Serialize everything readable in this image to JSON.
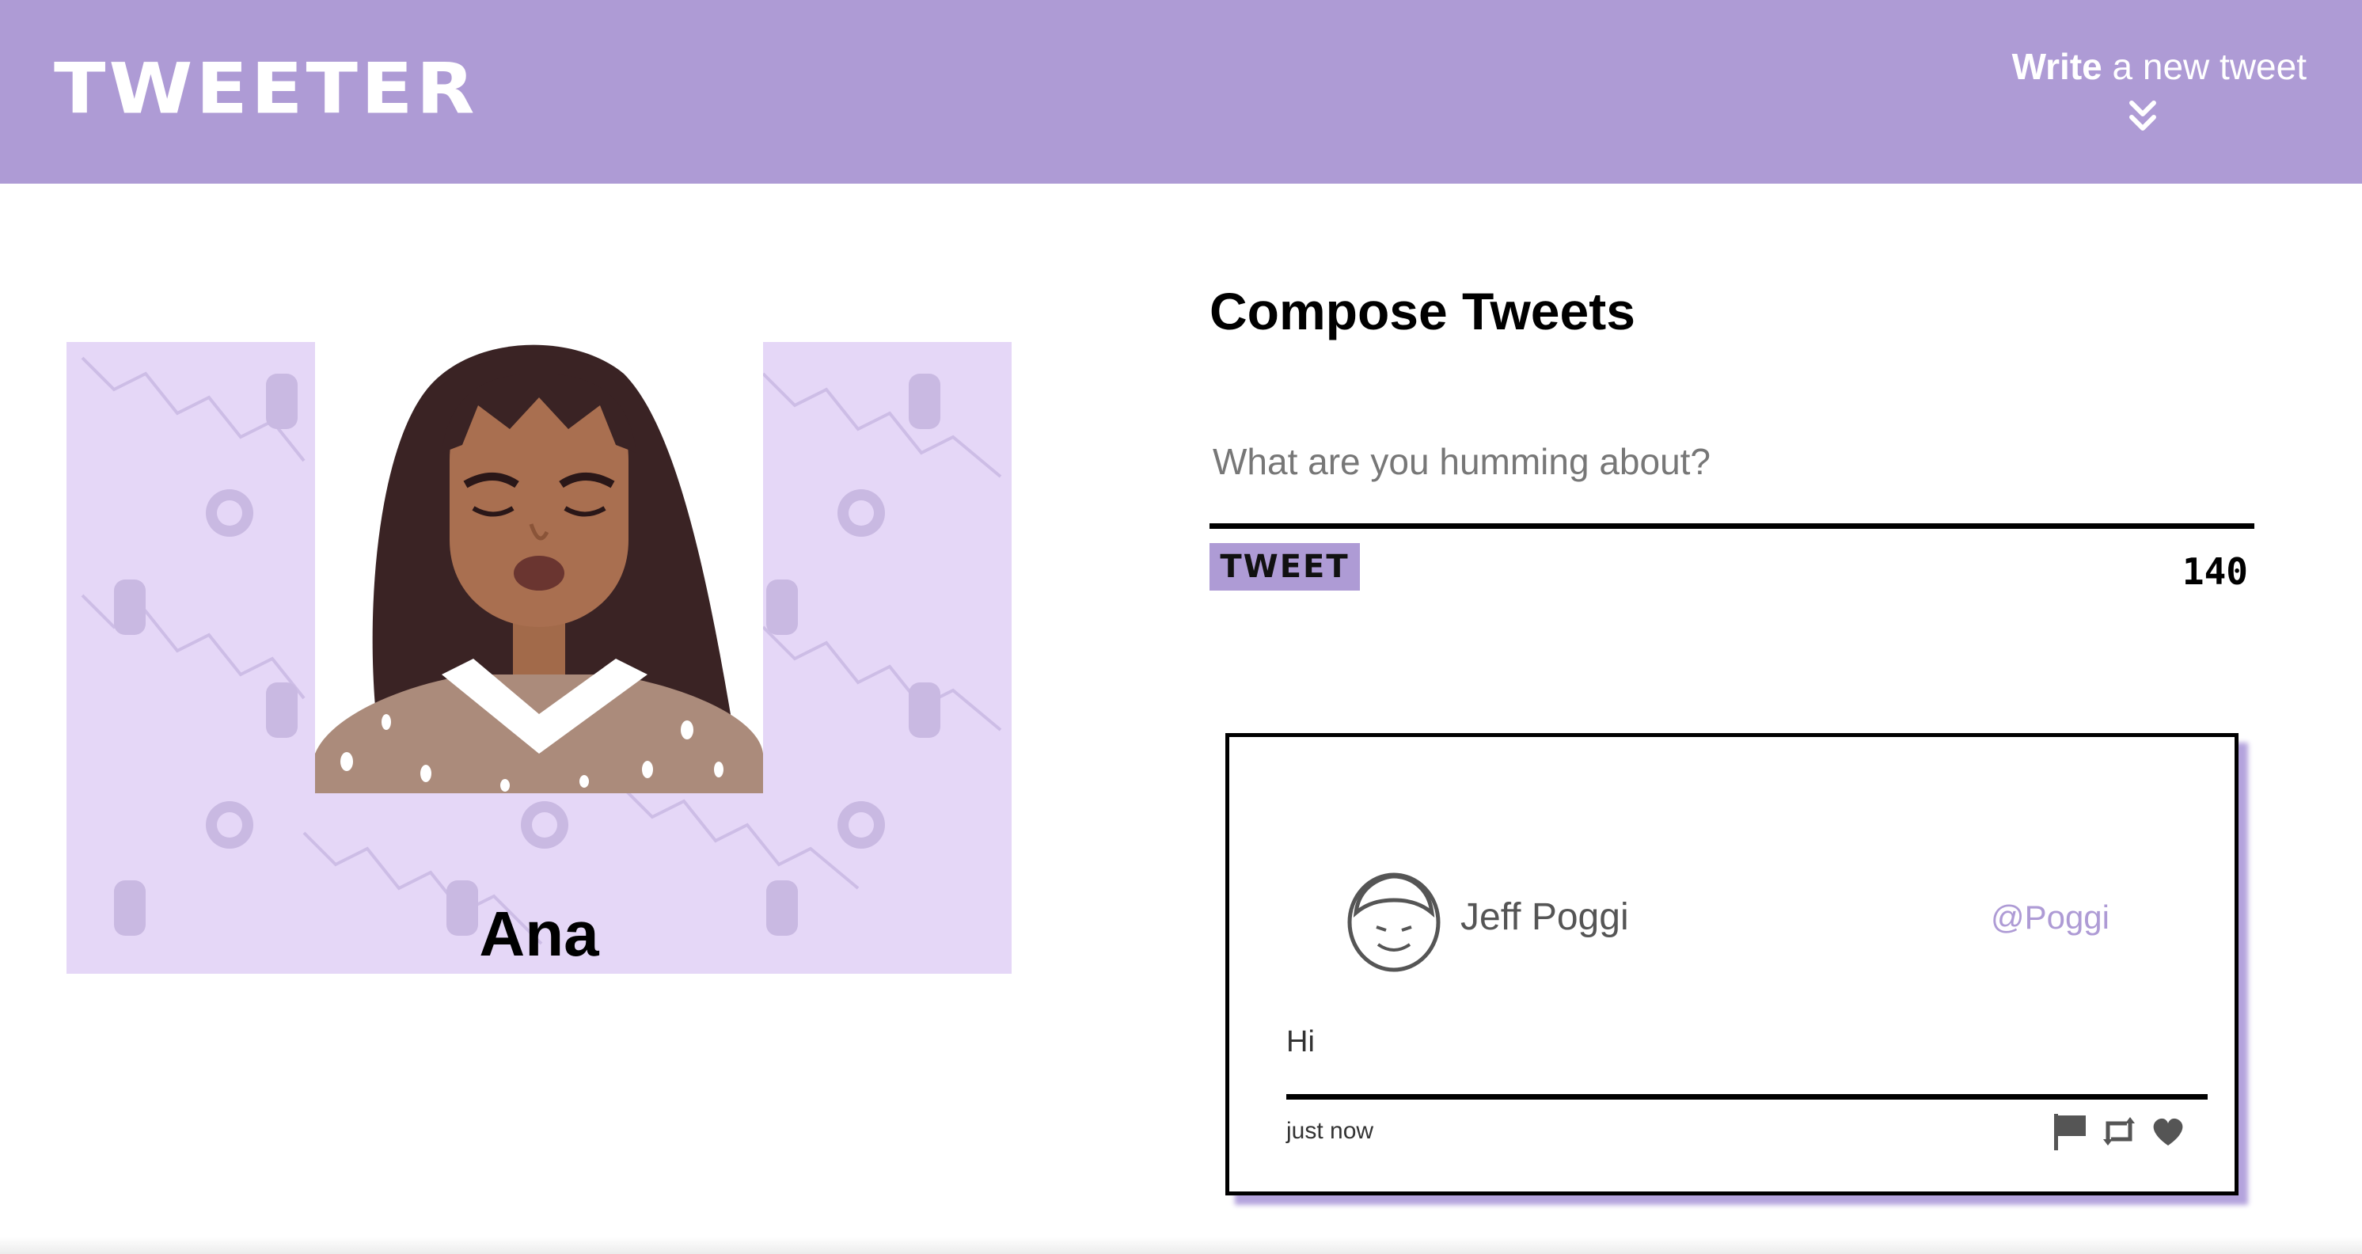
{
  "colors": {
    "accent": "#ae9bd5",
    "profile_background": "#e5d7f7",
    "text": "#000000",
    "muted_text": "#555555"
  },
  "nav": {
    "brand": "TWEETER",
    "write_strong": "Write",
    "write_rest": " a new tweet",
    "toggle_icon": "double-chevron-down-icon"
  },
  "profile": {
    "name": "Ana",
    "avatar_icon": "user-portrait"
  },
  "compose": {
    "title": "Compose Tweets",
    "placeholder": "What are you humming about?",
    "value": "",
    "button_label": "TWEET",
    "char_count": "140"
  },
  "tweets": [
    {
      "author": "Jeff Poggi",
      "handle": "@Poggi",
      "body": "Hi",
      "time": "just now",
      "avatar_icon": "user-face-icon",
      "actions": [
        "flag-icon",
        "retweet-icon",
        "heart-icon"
      ]
    }
  ]
}
